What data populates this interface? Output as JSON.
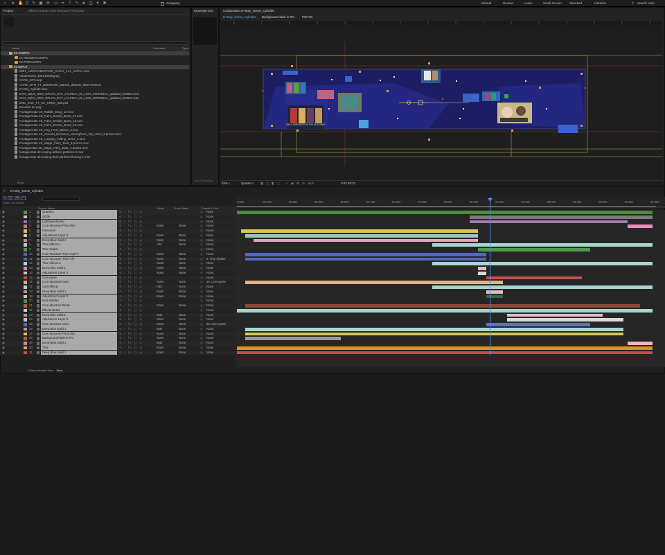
{
  "topbar": {
    "snapping": "Snapping",
    "workspaces": [
      "Default",
      "Review",
      "Learn",
      "Small Screen",
      "Standard",
      "Libraries"
    ],
    "search": "Search Help"
  },
  "project": {
    "tab_project": "Project",
    "tab_effects": "Effect Controls Core-structure-Pinocchio",
    "col_name": "Name",
    "col_comment": "Comment",
    "col_type": "Type",
    "items": [
      {
        "label": "01-COMPS",
        "type": "folder",
        "selected": true,
        "indent": 0
      },
      {
        "label": "01-RENDERCOMPS",
        "type": "folder",
        "selected": false,
        "indent": 1
      },
      {
        "label": "02-PRECOMPS",
        "type": "folder",
        "selected": false,
        "indent": 1
      },
      {
        "label": "02-INPUT",
        "type": "folder",
        "selected": true,
        "indent": 0
      },
      {
        "label": "0061_LOGOANIMATION_0+DAY_1x1_ALPHA.mov",
        "type": "file",
        "selected": false,
        "indent": 1
      },
      {
        "label": "AdobeStock_106148498.jpeg",
        "type": "file",
        "selected": false,
        "indent": 1
      },
      {
        "label": "CARS_GFX.aep",
        "type": "file",
        "selected": false,
        "indent": 1
      },
      {
        "label": "CARS_OTR_TT_DENMARK_Danish_dark8G_KEG+RGB.ai",
        "type": "file",
        "selected": false,
        "indent": 1
      },
      {
        "label": "D+Day_Cylinder.aep",
        "type": "file",
        "selected": false,
        "indent": 1
      },
      {
        "label": "DAN_Dplus_NRD_DPLUS_DAY_LAUNCH_30_16X9_INTERNAL_updated_010922.mov",
        "type": "file",
        "selected": false,
        "indent": 1
      },
      {
        "label": "DAN_Dplus_NRD_DPLUS_DAY_LAUNCH_30_16X9_INTERNAL_updated_010922.wav",
        "type": "file",
        "selected": false,
        "indent": 1
      },
      {
        "label": "ENC_ENC_TT_KC_KRKG_035.psd",
        "type": "file",
        "selected": false,
        "indent": 1
      },
      {
        "label": "Encante-6A.png",
        "type": "file",
        "selected": false,
        "indent": 1
      },
      {
        "label": "FootageCrate-4k_Rubble_Drop_12.mov",
        "type": "file",
        "selected": false,
        "indent": 1
      },
      {
        "label": "FootageCrate-4K_Faint_Smoke_Burst_17.mov",
        "type": "file",
        "selected": false,
        "indent": 1
      },
      {
        "label": "FootageCrate-4K_Faint_Smoke_Burst_18.mov",
        "type": "file",
        "selected": false,
        "indent": 1
      },
      {
        "label": "FootageCrate-4K_Faint_Smoke_Burst_20.mov",
        "type": "file",
        "selected": false,
        "indent": 1
      },
      {
        "label": "FootageCrate-4K_Fog_From_Below_3.mov",
        "type": "file",
        "selected": false,
        "indent": 1
      },
      {
        "label": "FootageCrate-4K_Ground_Emission_Atmosphere_Top_View_3-prores.mov",
        "type": "file",
        "selected": false,
        "indent": 1
      },
      {
        "label": "FootageCrate-4K_Looping_Falling_Snow_4.mov",
        "type": "file",
        "selected": false,
        "indent": 1
      },
      {
        "label": "FootageCrate-4K_Magic_Fairy_Dust_3-prores.mov",
        "type": "file",
        "selected": false,
        "indent": 1
      },
      {
        "label": "Footagecrate-4K_Magic_Fairy_Dust_4-prores.mov",
        "type": "file",
        "selected": false,
        "indent": 1
      },
      {
        "label": "footagecrate-4k-looping-airborn-particles-9.mov",
        "type": "file",
        "selected": false,
        "indent": 1
      },
      {
        "label": "footagecrate-4k-looping-dust-particles-flowing-1.mov",
        "type": "file",
        "selected": false,
        "indent": 1
      }
    ],
    "bpc": "8 bpc"
  },
  "essential": {
    "tab": "Essential Gra",
    "add_formatting": "Add Formatting"
  },
  "composition": {
    "title": "Composition D+Day_Dome_Cylinder",
    "tabs": [
      "D+Day_Dome_Cylinder",
      "Background-fade-in-IPs",
      "PISTOL"
    ],
    "zoom": "25%",
    "quality": "Quarter",
    "exposure": "+0,0",
    "timecode": "0:02:28:21",
    "poster_text": "ONLY MURDERS IN THE BUILDING"
  },
  "timeline": {
    "tab": "D+Day_Dome_Cylinder",
    "timecode": "0:02:28:21",
    "fps": "03621 (25.00 fps)",
    "headers": {
      "source": "Source Name",
      "mode": "Mode",
      "trkmat": "Track Matte",
      "parent": "Parent & Link"
    },
    "ruler": [
      "0:00s",
      "00:15s",
      "00:30s",
      "00:45s",
      "01:00s",
      "01:15s",
      "01:30s",
      "01:45s",
      "02:00s",
      "02:15s",
      "02:30s",
      "02:45s",
      "03:00s",
      "03:15s",
      "03:30s",
      "03:45s",
      "04:00s"
    ],
    "render_time_label": "Frame Render Time",
    "render_time_value": "16ms",
    "layers": [
      {
        "num": "1",
        "name": "Quarters",
        "label_color": "#5a8f3c",
        "mode": "",
        "matte": "",
        "parent": "None",
        "bar_color": "#4e8a3a",
        "start": 0.0,
        "end": 1.0
      },
      {
        "num": "2",
        "name": "Sizzle",
        "label_color": "#c7c7c7",
        "mode": "",
        "matte": "",
        "parent": "None",
        "bar_color": "#7a7a7a",
        "start": 0.56,
        "end": 1.0
      },
      {
        "num": "3",
        "name": "Lightspeed-jump",
        "label_color": "#9a6cb0",
        "mode": "",
        "matte": "",
        "parent": "None",
        "bar_color": "#a57ab8",
        "start": 0.56,
        "end": 0.94
      },
      {
        "num": "4",
        "name": "Core-structure-Pinocchio",
        "label_color": "#d06f9a",
        "mode": "Norm",
        "matte": "None",
        "parent": "None",
        "bar_color": "#e98db5",
        "start": 0.94,
        "end": 1.0
      },
      {
        "num": "5",
        "name": "Fairy-dust",
        "label_color": "#d8c54d",
        "mode": "",
        "matte": "",
        "parent": "None",
        "bar_color": "#d9c94f",
        "start": 0.01,
        "end": 0.58
      },
      {
        "num": "6",
        "name": "Adjustment Layer 3",
        "label_color": "#c7c7c7",
        "mode": "Norm",
        "matte": "None",
        "parent": "None",
        "bar_color": "#9ec4c0",
        "start": 0.02,
        "end": 0.58
      },
      {
        "num": "7",
        "name": "Deep Blue Solid 1",
        "label_color": "#c98b9a",
        "mode": "Norm",
        "matte": "None",
        "parent": "None",
        "bar_color": "#e2a6b6",
        "start": 0.04,
        "end": 0.58
      },
      {
        "num": "8",
        "name": "Thor-effects-1",
        "label_color": "#a7d6cf",
        "mode": "Add",
        "matte": "None",
        "parent": "None",
        "bar_color": "#a7d6cf",
        "start": 0.47,
        "end": 1.0
      },
      {
        "num": "9",
        "name": "Thor-shaker",
        "label_color": "#5a8f3c",
        "mode": "",
        "matte": "",
        "parent": "None",
        "bar_color": "#4e9a4a",
        "start": 0.58,
        "end": 0.85
      },
      {
        "num": "10",
        "name": "Core-structure-Thor-onlyTT",
        "label_color": "#4c66c7",
        "mode": "Norm",
        "matte": "None",
        "parent": "None",
        "bar_color": "#4e68c4",
        "start": 0.02,
        "end": 0.6
      },
      {
        "num": "11",
        "name": "Core-structure-Thor-ref?",
        "label_color": "#4c66c7",
        "mode": "Norm",
        "matte": "None",
        "parent": "9. Thor-shaker",
        "bar_color": "#4e68c4",
        "start": 0.02,
        "end": 0.6
      },
      {
        "num": "12",
        "name": "Thor-effects-2",
        "label_color": "#a7d6cf",
        "mode": "Norm",
        "matte": "None",
        "parent": "None",
        "bar_color": "#a7d6cf",
        "start": 0.47,
        "end": 1.0
      },
      {
        "num": "13",
        "name": "Deep blue Solid 1",
        "label_color": "#c98b9a",
        "mode": "Norm",
        "matte": "None",
        "parent": "None",
        "bar_color": "#e8b7c2",
        "start": 0.58,
        "end": 0.6
      },
      {
        "num": "14",
        "name": "Adjustment Layer 3",
        "label_color": "#c7c7c7",
        "mode": "Norm",
        "matte": "None",
        "parent": "None",
        "bar_color": "#d9d9d9",
        "start": 0.58,
        "end": 0.6
      },
      {
        "num": "15",
        "name": "Cars-pulse",
        "label_color": "#c94a4a",
        "mode": "",
        "matte": "",
        "parent": "None",
        "bar_color": "#c84c4c",
        "start": 0.6,
        "end": 0.83
      },
      {
        "num": "16",
        "name": "Core-structure-Cars",
        "label_color": "#d9a47a",
        "mode": "Norm",
        "matte": "None",
        "parent": "15. Cars-pulse",
        "bar_color": "#e1b287",
        "start": 0.02,
        "end": 0.64
      },
      {
        "num": "17",
        "name": "Cars-effects",
        "label_color": "#a7d6cf",
        "mode": "Add",
        "matte": "None",
        "parent": "None",
        "bar_color": "#a7d6cf",
        "start": 0.47,
        "end": 1.0
      },
      {
        "num": "18",
        "name": "Deep Blue Solid 1",
        "label_color": "#c98b9a",
        "mode": "Norm",
        "matte": "None",
        "parent": "None",
        "bar_color": "#e8b7c2",
        "start": 0.6,
        "end": 0.64
      },
      {
        "num": "19",
        "name": "Adjustment Layer 3",
        "label_color": "#c7c7c7",
        "mode": "Norm",
        "matte": "None",
        "parent": "None",
        "bar_color": "#2f6b4a",
        "start": 0.6,
        "end": 0.64
      },
      {
        "num": "20",
        "name": "Mud-splatter",
        "label_color": "#5a8f3c",
        "mode": "",
        "matte": "",
        "parent": "None",
        "bar_color": "#3a3a3a",
        "start": 0.0,
        "end": 0.0
      },
      {
        "num": "21",
        "name": "Core-structure-Bertie",
        "label_color": "#a86040",
        "mode": "Norm",
        "matte": "None",
        "parent": "None",
        "bar_color": "#8c4a34",
        "start": 0.02,
        "end": 0.97
      },
      {
        "num": "22",
        "name": "Effects-Bertie",
        "label_color": "#a7d6cf",
        "mode": "",
        "matte": "",
        "parent": "None",
        "bar_color": "#a7d6cf",
        "start": 0.0,
        "end": 1.0
      },
      {
        "num": "23",
        "name": "Deep blue Solid 1",
        "label_color": "#c98b9a",
        "mode": "Mult",
        "matte": "None",
        "parent": "None",
        "bar_color": "#e8b7c2",
        "start": 0.65,
        "end": 0.88
      },
      {
        "num": "24",
        "name": "Adjustment Layer 3",
        "label_color": "#c7c7c7",
        "mode": "Norm",
        "matte": "None",
        "parent": "None",
        "bar_color": "#d9d9d9",
        "start": 0.65,
        "end": 0.93
      },
      {
        "num": "25",
        "name": "Core-structure-Cars",
        "label_color": "#4c66c7",
        "mode": "Norm",
        "matte": "None",
        "parent": "15. Cars-pulse",
        "bar_color": "#5a6fd0",
        "start": 0.6,
        "end": 0.85
      },
      {
        "num": "26",
        "name": "Deep Blue Solid 1",
        "label_color": "#c98b9a",
        "mode": "Mult",
        "matte": "None",
        "parent": "None",
        "bar_color": "#a7d6cf",
        "start": 0.02,
        "end": 0.93
      },
      {
        "num": "27",
        "name": "Core-structure-Pinocchio",
        "label_color": "#d8c54d",
        "mode": "Norm",
        "matte": "None",
        "parent": "None",
        "bar_color": "#d9c94f",
        "start": 0.02,
        "end": 0.93
      },
      {
        "num": "28",
        "name": "Background-fade-in-IPs",
        "label_color": "#a86040",
        "mode": "Norm",
        "matte": "None",
        "parent": "None",
        "bar_color": "#9a9a9a",
        "start": 0.02,
        "end": 0.25
      },
      {
        "num": "29",
        "name": "Deep Blue Solid 1",
        "label_color": "#c98b9a",
        "mode": "Mult",
        "matte": "None",
        "parent": "None",
        "bar_color": "#e8b7c2",
        "start": 0.94,
        "end": 1.0
      },
      {
        "num": "30",
        "name": "Thor",
        "label_color": "#d9a47a",
        "mode": "Norm",
        "matte": "None",
        "parent": "None",
        "bar_color": "#d9922e",
        "start": 0.0,
        "end": 1.0
      },
      {
        "num": "31",
        "name": "Deep Blue Solid 1",
        "label_color": "#c94a4a",
        "mode": "Norm",
        "matte": "None",
        "parent": "None",
        "bar_color": "#c84c4c",
        "start": 0.0,
        "end": 1.0
      }
    ]
  }
}
